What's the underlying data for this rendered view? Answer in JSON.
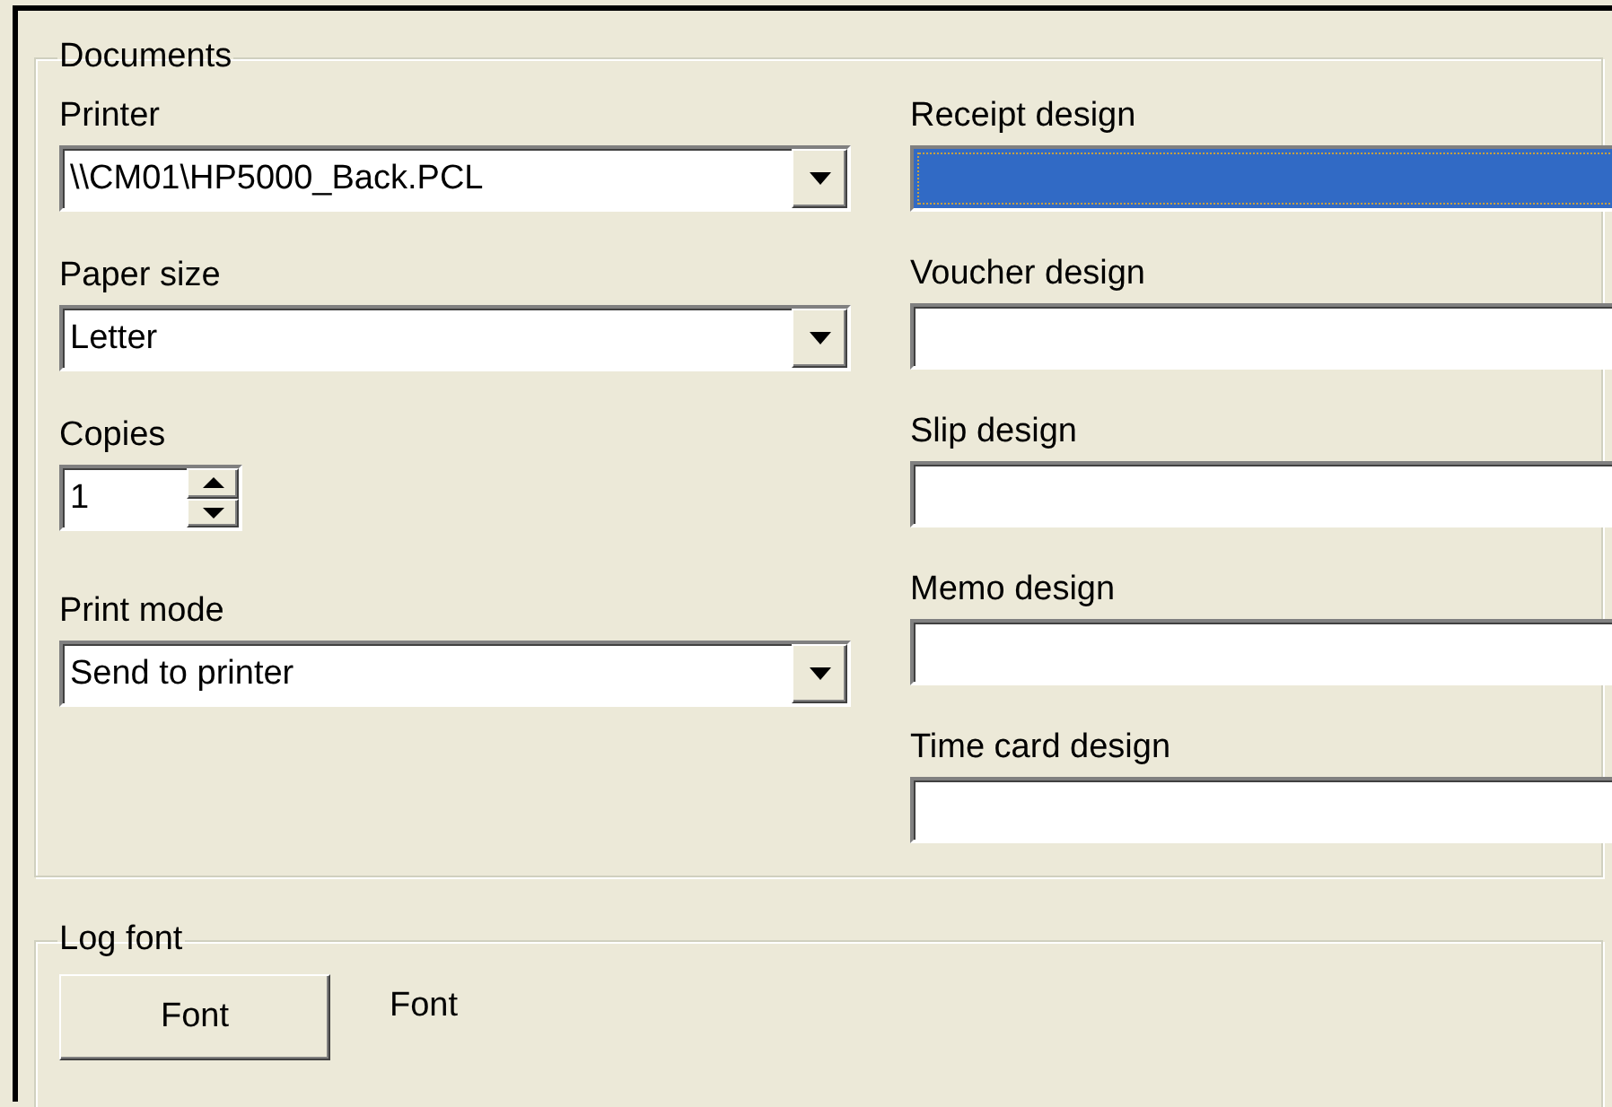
{
  "documents": {
    "title": "Documents",
    "left_fields": [
      {
        "label": "Printer",
        "kind": "combo",
        "value": "\\\\CM01\\HP5000_Back.PCL"
      },
      {
        "label": "Paper size",
        "kind": "combo",
        "value": "Letter"
      },
      {
        "label": "Copies",
        "kind": "spin",
        "value": "1"
      },
      {
        "label": "Print mode",
        "kind": "combo",
        "value": "Send to printer"
      }
    ],
    "design_fields": [
      {
        "label": "Receipt design",
        "selected": true
      },
      {
        "label": "Voucher design",
        "selected": false
      },
      {
        "label": "Slip design",
        "selected": false
      },
      {
        "label": "Memo design",
        "selected": false
      },
      {
        "label": "Time card design",
        "selected": false
      }
    ]
  },
  "log_font": {
    "title": "Log font",
    "button": "Font",
    "font_name": "Font"
  }
}
